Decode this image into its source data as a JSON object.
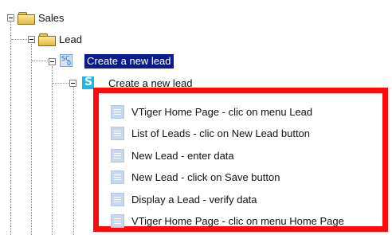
{
  "tree": {
    "root": {
      "label": "Sales",
      "icon": "folder-icon"
    },
    "folder": {
      "label": "Lead",
      "icon": "folder-icon"
    },
    "scenario": {
      "label": "Create a new lead",
      "icon": "scenario-icon",
      "icon_text": "SC",
      "icon_subscript": "0",
      "selected": true
    },
    "test_case": {
      "label": "Create a new lead",
      "icon": "test-case-icon"
    }
  },
  "steps": [
    {
      "label": "VTiger Home Page - clic on menu Lead",
      "icon": "step-icon"
    },
    {
      "label": "List of Leads - clic on New Lead button",
      "icon": "step-icon"
    },
    {
      "label": "New Lead - enter data",
      "icon": "step-icon"
    },
    {
      "label": "New Lead - click on Save button",
      "icon": "step-icon"
    },
    {
      "label": "Display a Lead - verify data",
      "icon": "step-icon"
    },
    {
      "label": "VTiger Home Page - clic on menu Home Page",
      "icon": "step-icon"
    }
  ],
  "colors": {
    "selection": "#0b1a8c",
    "highlight_border": "#ff0a0a"
  }
}
